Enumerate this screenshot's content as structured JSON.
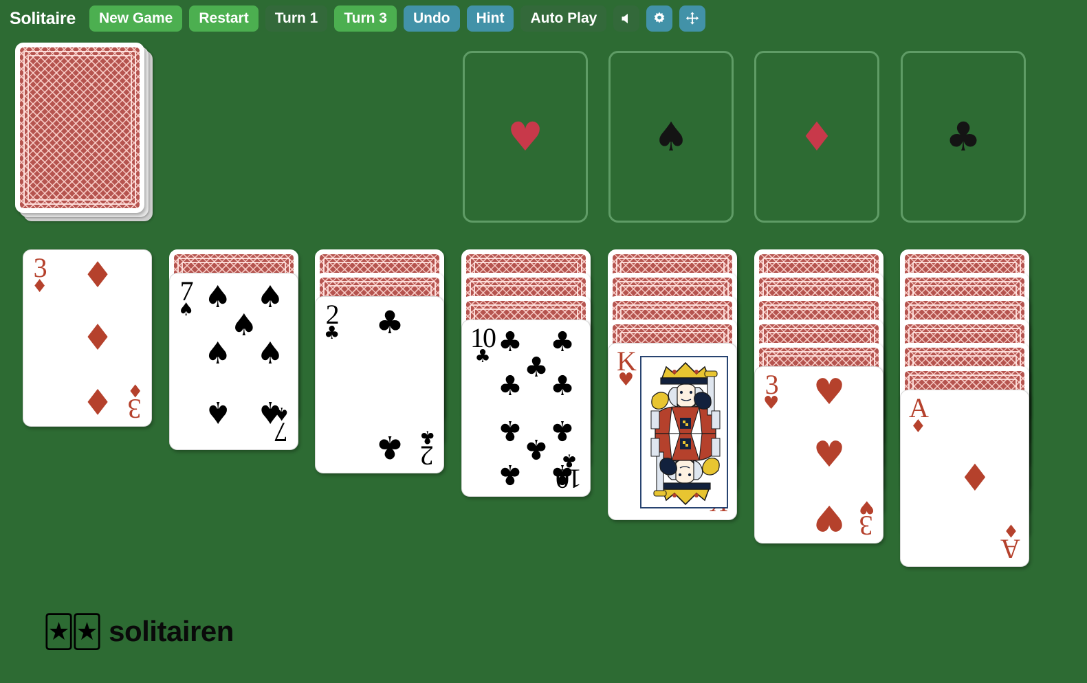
{
  "app": {
    "title": "Solitaire",
    "background_color": "#2d6b33"
  },
  "toolbar": {
    "buttons": [
      {
        "label": "New Game",
        "name": "new-game-button",
        "style": "green-light"
      },
      {
        "label": "Restart",
        "name": "restart-button",
        "style": "green-light"
      },
      {
        "label": "Turn 1",
        "name": "turn-1-button",
        "style": "green-dark"
      },
      {
        "label": "Turn 3",
        "name": "turn-3-button",
        "style": "green-light"
      },
      {
        "label": "Undo",
        "name": "undo-button",
        "style": "blue"
      },
      {
        "label": "Hint",
        "name": "hint-button",
        "style": "blue"
      },
      {
        "label": "Auto Play",
        "name": "auto-play-button",
        "style": "green-dark"
      }
    ],
    "icon_buttons": [
      {
        "icon": "sound-icon",
        "name": "sound-toggle-button",
        "style": "green-dark"
      },
      {
        "icon": "gear-icon",
        "name": "settings-button",
        "style": "blue"
      },
      {
        "icon": "fullscreen-icon",
        "name": "fullscreen-button",
        "style": "blue"
      }
    ],
    "colors": {
      "green_light": "#4caf50",
      "green_dark": "#33693a",
      "blue": "#4292a8",
      "text": "#ffffff"
    }
  },
  "stock": {
    "name": "stock-pile",
    "face_down": true,
    "stacked": true
  },
  "foundations": [
    {
      "suit": "hearts",
      "glyph": "♥",
      "color": "red",
      "empty": true,
      "name": "foundation-hearts"
    },
    {
      "suit": "spades",
      "glyph": "♠",
      "color": "black",
      "empty": true,
      "name": "foundation-spades"
    },
    {
      "suit": "diamonds",
      "glyph": "♦",
      "color": "red",
      "empty": true,
      "name": "foundation-diamonds"
    },
    {
      "suit": "clubs",
      "glyph": "♣",
      "color": "black",
      "empty": true,
      "name": "foundation-clubs"
    }
  ],
  "tableau": [
    {
      "name": "tableau-column-1",
      "face_down_count": 0,
      "face_up": {
        "rank": "3",
        "suit": "diamonds",
        "glyph": "♦",
        "color": "red",
        "label": "3 of Diamonds"
      }
    },
    {
      "name": "tableau-column-2",
      "face_down_count": 1,
      "face_up": {
        "rank": "7",
        "suit": "spades",
        "glyph": "♠",
        "color": "black",
        "label": "7 of Spades"
      }
    },
    {
      "name": "tableau-column-3",
      "face_down_count": 2,
      "face_up": {
        "rank": "2",
        "suit": "clubs",
        "glyph": "♣",
        "color": "black",
        "label": "2 of Clubs"
      }
    },
    {
      "name": "tableau-column-4",
      "face_down_count": 3,
      "face_up": {
        "rank": "10",
        "suit": "clubs",
        "glyph": "♣",
        "color": "black",
        "label": "10 of Clubs"
      }
    },
    {
      "name": "tableau-column-5",
      "face_down_count": 4,
      "face_up": {
        "rank": "K",
        "suit": "hearts",
        "glyph": "♥",
        "color": "red",
        "label": "King of Hearts",
        "court": true
      }
    },
    {
      "name": "tableau-column-6",
      "face_down_count": 5,
      "face_up": {
        "rank": "3",
        "suit": "hearts",
        "glyph": "♥",
        "color": "red",
        "label": "3 of Hearts"
      }
    },
    {
      "name": "tableau-column-7",
      "face_down_count": 6,
      "face_up": {
        "rank": "A",
        "suit": "diamonds",
        "glyph": "♦",
        "color": "red",
        "label": "Ace of Diamonds"
      }
    }
  ],
  "branding": {
    "mark": "🃏🃏",
    "text": "solitairen"
  },
  "card_colors": {
    "back_red": "#b5544f",
    "back_lattice": "#ffd7d2",
    "face_white": "#ffffff",
    "red_suit": "#b5412c",
    "black_suit": "#000000",
    "foundation_outline": "#5f9c66"
  }
}
